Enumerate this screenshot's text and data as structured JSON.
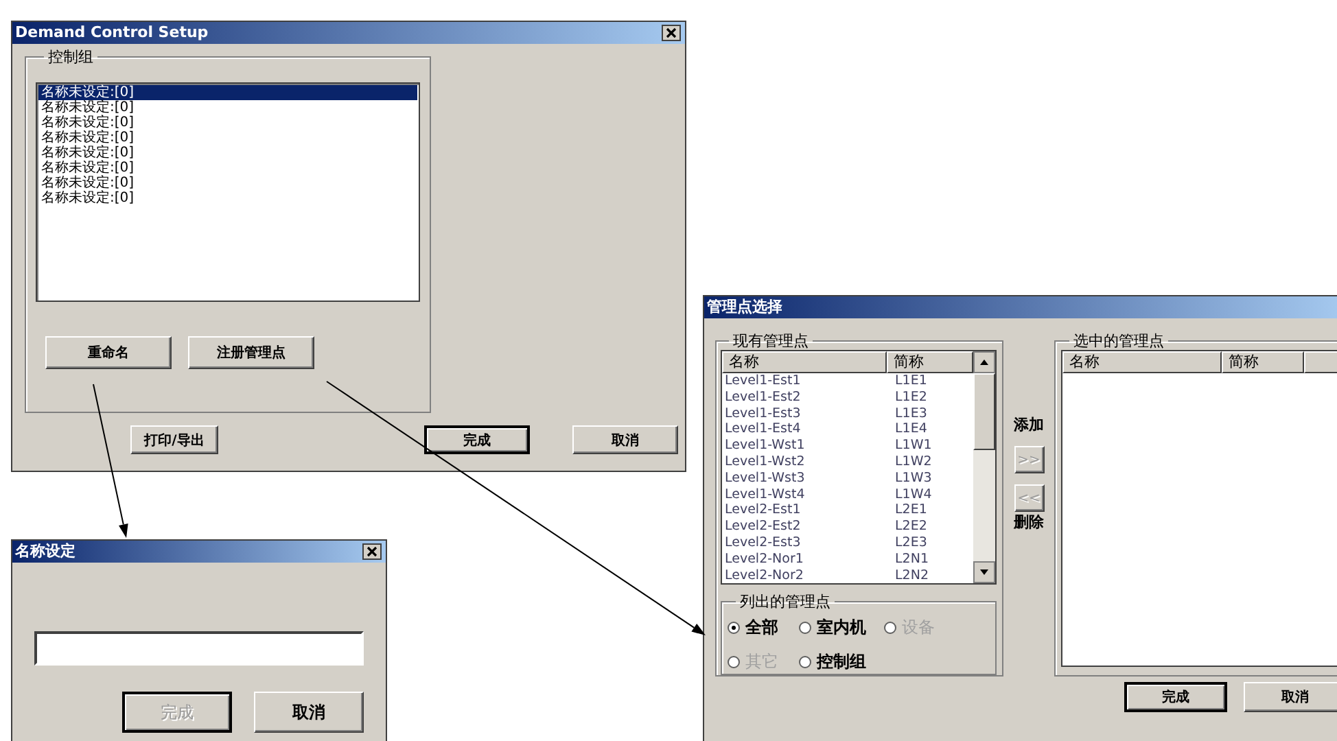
{
  "main_window": {
    "title": "Demand Control Setup",
    "group_label": "控制组",
    "list_items": [
      {
        "label": "名称未设定:[0]",
        "selected": true
      },
      {
        "label": "名称未设定:[0]",
        "selected": false
      },
      {
        "label": "名称未设定:[0]",
        "selected": false
      },
      {
        "label": "名称未设定:[0]",
        "selected": false
      },
      {
        "label": "名称未设定:[0]",
        "selected": false
      },
      {
        "label": "名称未设定:[0]",
        "selected": false
      },
      {
        "label": "名称未设定:[0]",
        "selected": false
      },
      {
        "label": "名称未设定:[0]",
        "selected": false
      }
    ],
    "group_buttons": [
      {
        "label": "重命名",
        "default": false
      },
      {
        "label": "注册管理点",
        "default": false
      }
    ],
    "print_button": {
      "label": "打印/导出",
      "default": false
    },
    "buttons": [
      {
        "label": "完成",
        "default": true
      },
      {
        "label": "取消",
        "default": false
      }
    ]
  },
  "name_dialog": {
    "title": "名称设定",
    "buttons": [
      {
        "label": "完成",
        "default": true,
        "disabled": true
      },
      {
        "label": "取消",
        "default": false,
        "disabled": false
      }
    ]
  },
  "point_dialog": {
    "title": "管理点选择",
    "available_label": "现有管理点",
    "columns": [
      "名称",
      "简称"
    ],
    "points": [
      {
        "name": "Level1-Est1",
        "short": "L1E1"
      },
      {
        "name": "Level1-Est2",
        "short": "L1E2"
      },
      {
        "name": "Level1-Est3",
        "short": "L1E3"
      },
      {
        "name": "Level1-Est4",
        "short": "L1E4"
      },
      {
        "name": "Level1-Wst1",
        "short": "L1W1"
      },
      {
        "name": "Level1-Wst2",
        "short": "L1W2"
      },
      {
        "name": "Level1-Wst3",
        "short": "L1W3"
      },
      {
        "name": "Level1-Wst4",
        "short": "L1W4"
      },
      {
        "name": "Level2-Est1",
        "short": "L2E1"
      },
      {
        "name": "Level2-Est2",
        "short": "L2E2"
      },
      {
        "name": "Level2-Est3",
        "short": "L2E3"
      },
      {
        "name": "Level2-Nor1",
        "short": "L2N1"
      },
      {
        "name": "Level2-Nor2",
        "short": "L2N2"
      }
    ],
    "filter_label": "列出的管理点",
    "filter_options": [
      {
        "label": "全部",
        "selected": true,
        "disabled": false
      },
      {
        "label": "室内机",
        "selected": false,
        "disabled": false
      },
      {
        "label": "设备",
        "selected": false,
        "disabled": true
      },
      {
        "label": "其它",
        "selected": false,
        "disabled": true
      },
      {
        "label": "控制组",
        "selected": false,
        "disabled": false
      }
    ],
    "add_label": "添加",
    "add_button": {
      "label": ">>",
      "disabled": true
    },
    "remove_button": {
      "label": "<<",
      "disabled": true
    },
    "remove_label": "删除",
    "selected_label": "选中的管理点",
    "selected_columns": [
      "名称",
      "简称"
    ],
    "buttons": [
      {
        "label": "完成",
        "default": true,
        "disabled": false
      },
      {
        "label": "取消",
        "default": false,
        "disabled": false
      }
    ]
  }
}
